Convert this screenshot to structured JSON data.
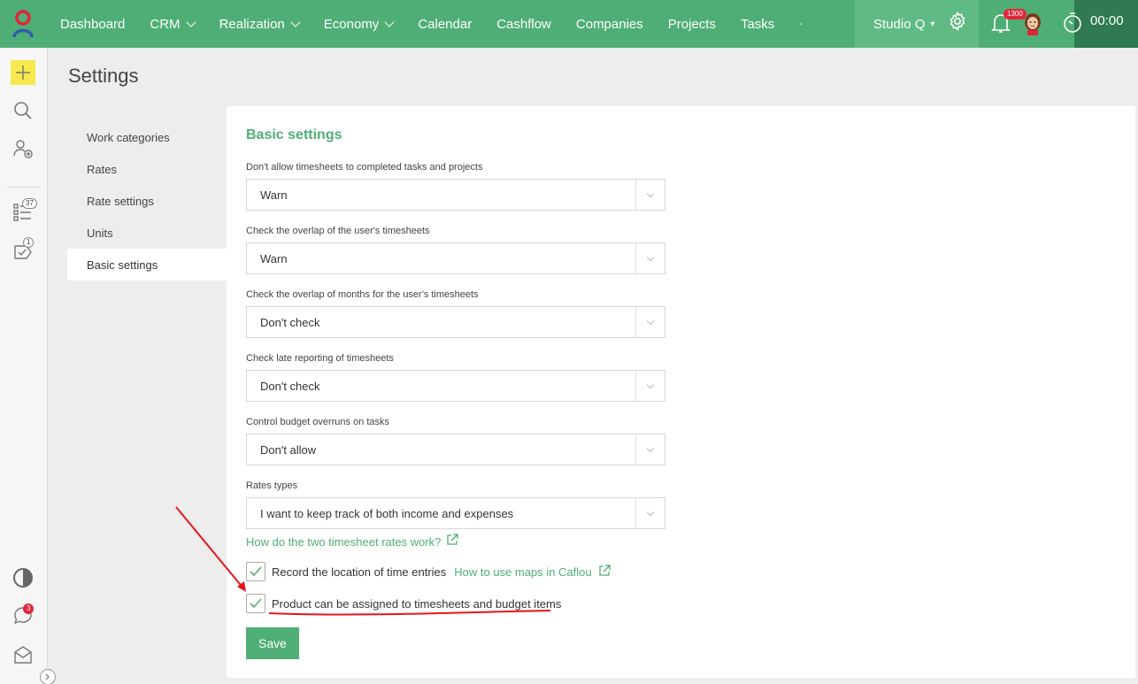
{
  "topnav": {
    "items": [
      {
        "label": "Dashboard",
        "dropdown": false
      },
      {
        "label": "CRM",
        "dropdown": true
      },
      {
        "label": "Realization",
        "dropdown": true
      },
      {
        "label": "Economy",
        "dropdown": true
      },
      {
        "label": "Calendar",
        "dropdown": false
      },
      {
        "label": "Cashflow",
        "dropdown": false
      },
      {
        "label": "Companies",
        "dropdown": false
      },
      {
        "label": "Projects",
        "dropdown": false
      },
      {
        "label": "Tasks",
        "dropdown": false
      }
    ],
    "more_symbol": "-",
    "workspace": "Studio Q",
    "notification_count": "1300",
    "timer": "00:00"
  },
  "rail": {
    "tasks_badge": "37",
    "approvals_badge": "1",
    "chat_badge": "3"
  },
  "page": {
    "title": "Settings",
    "subnav": [
      "Work categories",
      "Rates",
      "Rate settings",
      "Units",
      "Basic settings"
    ]
  },
  "basic": {
    "title": "Basic settings",
    "fields": [
      {
        "label": "Don't allow timesheets to completed tasks and projects",
        "value": "Warn"
      },
      {
        "label": "Check the overlap of the user's timesheets",
        "value": "Warn"
      },
      {
        "label": "Check the overlap of months for the user's timesheets",
        "value": "Don't check"
      },
      {
        "label": "Check late reporting of timesheets",
        "value": "Don't check"
      },
      {
        "label": "Control budget overruns on tasks",
        "value": "Don't allow"
      },
      {
        "label": "Rates types",
        "value": "I want to keep track of both income and expenses"
      }
    ],
    "rates_help_link": "How do the two timesheet rates work?",
    "record_location_label": "Record the location of time entries",
    "record_location_checked": true,
    "maps_help_link": "How to use maps in Caflou",
    "product_label": "Product can be assigned to timesheets and budget items",
    "product_checked": true,
    "save_label": "Save"
  },
  "colors": {
    "brand": "#4fae75",
    "brand_dark": "#2f7a51",
    "annotation": "#e8141c"
  }
}
